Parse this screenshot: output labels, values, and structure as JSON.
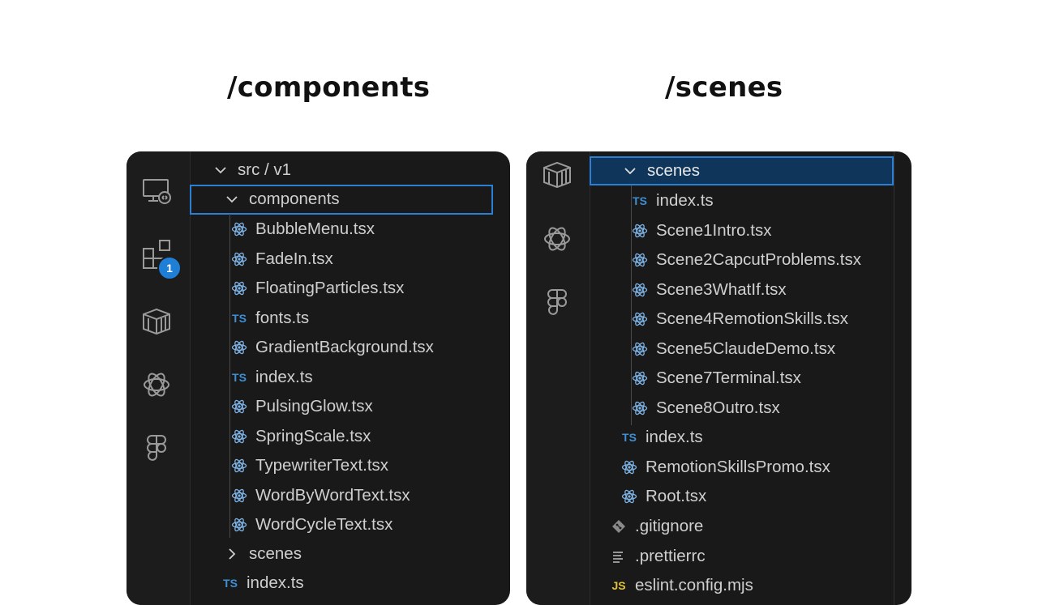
{
  "headings": {
    "left": "/components",
    "right": "/scenes"
  },
  "left_panel": {
    "notification_badge": "1",
    "activity_icons": [
      "remote-explorer-icon",
      "extensions-icon",
      "container-icon",
      "openai-icon",
      "figma-icon"
    ],
    "tree": {
      "root": "src / v1",
      "folder_expanded": "components",
      "files": [
        {
          "name": "BubbleMenu.tsx",
          "icon": "react-icon"
        },
        {
          "name": "FadeIn.tsx",
          "icon": "react-icon"
        },
        {
          "name": "FloatingParticles.tsx",
          "icon": "react-icon"
        },
        {
          "name": "fonts.ts",
          "icon": "ts-icon"
        },
        {
          "name": "GradientBackground.tsx",
          "icon": "react-icon"
        },
        {
          "name": "index.ts",
          "icon": "ts-icon"
        },
        {
          "name": "PulsingGlow.tsx",
          "icon": "react-icon"
        },
        {
          "name": "SpringScale.tsx",
          "icon": "react-icon"
        },
        {
          "name": "TypewriterText.tsx",
          "icon": "react-icon"
        },
        {
          "name": "WordByWordText.tsx",
          "icon": "react-icon"
        },
        {
          "name": "WordCycleText.tsx",
          "icon": "react-icon"
        }
      ],
      "folder_collapsed": "scenes",
      "trailing_file": "index.ts"
    }
  },
  "right_panel": {
    "activity_icons": [
      "container-icon",
      "openai-icon",
      "figma-icon"
    ],
    "tree": {
      "folder_expanded": "scenes",
      "files": [
        {
          "name": "index.ts",
          "icon": "ts-icon"
        },
        {
          "name": "Scene1Intro.tsx",
          "icon": "react-icon"
        },
        {
          "name": "Scene2CapcutProblems.tsx",
          "icon": "react-icon"
        },
        {
          "name": "Scene3WhatIf.tsx",
          "icon": "react-icon"
        },
        {
          "name": "Scene4RemotionSkills.tsx",
          "icon": "react-icon"
        },
        {
          "name": "Scene5ClaudeDemo.tsx",
          "icon": "react-icon"
        },
        {
          "name": "Scene7Terminal.tsx",
          "icon": "react-icon"
        },
        {
          "name": "Scene8Outro.tsx",
          "icon": "react-icon"
        }
      ],
      "sibling_files": [
        {
          "name": "index.ts",
          "icon": "ts-icon"
        },
        {
          "name": "RemotionSkillsPromo.tsx",
          "icon": "react-icon"
        },
        {
          "name": "Root.tsx",
          "icon": "react-icon"
        }
      ],
      "root_files": [
        {
          "name": ".gitignore",
          "icon": "git-icon"
        },
        {
          "name": ".prettierrc",
          "icon": "lines-icon"
        },
        {
          "name": "eslint.config.mjs",
          "icon": "js-icon"
        }
      ]
    }
  },
  "colors": {
    "panel_bg": "#191919",
    "selection_border": "#2b7fd4",
    "selection_fill": "#10355a",
    "ts_blue": "#3d8fd6",
    "react_blue": "#7fb4e6",
    "badge": "#1f7fd6"
  }
}
